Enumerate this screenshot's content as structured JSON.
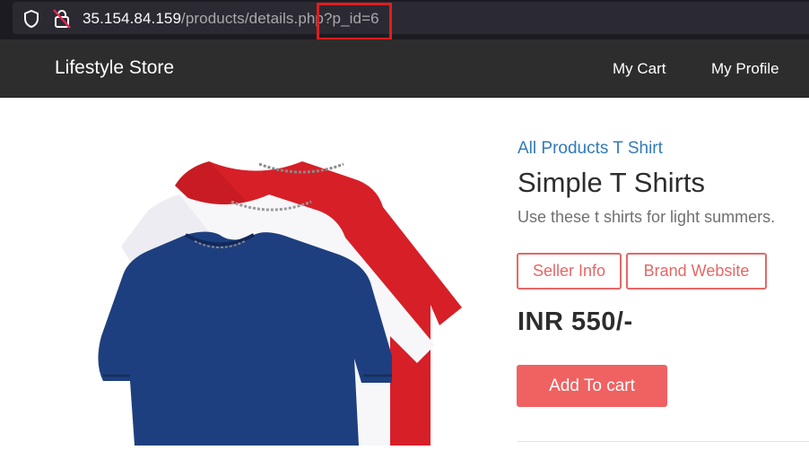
{
  "browser": {
    "url_host": "35.154.84.159",
    "url_path": "/products/details.php",
    "url_query": "?p_id=6"
  },
  "navbar": {
    "brand": "Lifestyle Store",
    "links": [
      "My Cart",
      "My Profile"
    ]
  },
  "product": {
    "breadcrumb": "All Products T Shirt",
    "title": "Simple T Shirts",
    "description": "Use these t shirts for light summers.",
    "seller_info_label": "Seller Info",
    "brand_website_label": "Brand Website",
    "price": "INR 550/-",
    "add_to_cart_label": "Add To cart",
    "image_icon": "tshirt-stack-image",
    "shirt_colors": [
      "#1e3f7f",
      "#f7f7fa",
      "#d71f28"
    ]
  },
  "colors": {
    "accent": "#f06262",
    "link": "#337ab7",
    "navbar": "#2d2d2d",
    "annotation": "#e11d1d"
  }
}
